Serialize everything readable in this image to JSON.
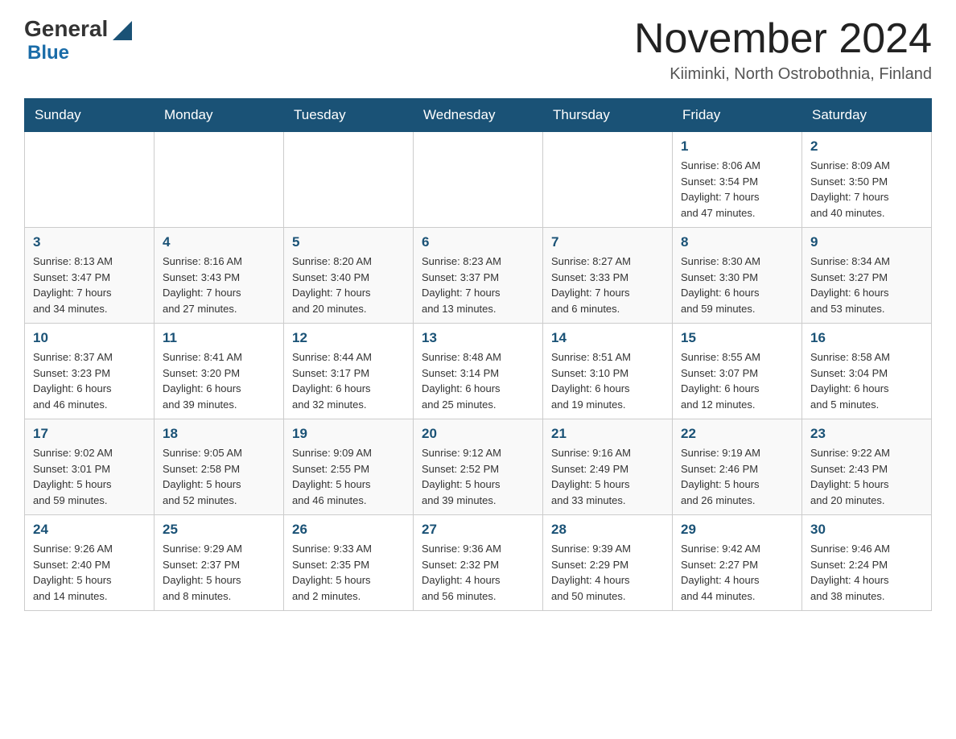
{
  "header": {
    "logo_general": "General",
    "logo_blue": "Blue",
    "month_title": "November 2024",
    "location": "Kiiminki, North Ostrobothnia, Finland"
  },
  "weekdays": [
    "Sunday",
    "Monday",
    "Tuesday",
    "Wednesday",
    "Thursday",
    "Friday",
    "Saturday"
  ],
  "weeks": [
    [
      {
        "day": "",
        "info": ""
      },
      {
        "day": "",
        "info": ""
      },
      {
        "day": "",
        "info": ""
      },
      {
        "day": "",
        "info": ""
      },
      {
        "day": "",
        "info": ""
      },
      {
        "day": "1",
        "info": "Sunrise: 8:06 AM\nSunset: 3:54 PM\nDaylight: 7 hours\nand 47 minutes."
      },
      {
        "day": "2",
        "info": "Sunrise: 8:09 AM\nSunset: 3:50 PM\nDaylight: 7 hours\nand 40 minutes."
      }
    ],
    [
      {
        "day": "3",
        "info": "Sunrise: 8:13 AM\nSunset: 3:47 PM\nDaylight: 7 hours\nand 34 minutes."
      },
      {
        "day": "4",
        "info": "Sunrise: 8:16 AM\nSunset: 3:43 PM\nDaylight: 7 hours\nand 27 minutes."
      },
      {
        "day": "5",
        "info": "Sunrise: 8:20 AM\nSunset: 3:40 PM\nDaylight: 7 hours\nand 20 minutes."
      },
      {
        "day": "6",
        "info": "Sunrise: 8:23 AM\nSunset: 3:37 PM\nDaylight: 7 hours\nand 13 minutes."
      },
      {
        "day": "7",
        "info": "Sunrise: 8:27 AM\nSunset: 3:33 PM\nDaylight: 7 hours\nand 6 minutes."
      },
      {
        "day": "8",
        "info": "Sunrise: 8:30 AM\nSunset: 3:30 PM\nDaylight: 6 hours\nand 59 minutes."
      },
      {
        "day": "9",
        "info": "Sunrise: 8:34 AM\nSunset: 3:27 PM\nDaylight: 6 hours\nand 53 minutes."
      }
    ],
    [
      {
        "day": "10",
        "info": "Sunrise: 8:37 AM\nSunset: 3:23 PM\nDaylight: 6 hours\nand 46 minutes."
      },
      {
        "day": "11",
        "info": "Sunrise: 8:41 AM\nSunset: 3:20 PM\nDaylight: 6 hours\nand 39 minutes."
      },
      {
        "day": "12",
        "info": "Sunrise: 8:44 AM\nSunset: 3:17 PM\nDaylight: 6 hours\nand 32 minutes."
      },
      {
        "day": "13",
        "info": "Sunrise: 8:48 AM\nSunset: 3:14 PM\nDaylight: 6 hours\nand 25 minutes."
      },
      {
        "day": "14",
        "info": "Sunrise: 8:51 AM\nSunset: 3:10 PM\nDaylight: 6 hours\nand 19 minutes."
      },
      {
        "day": "15",
        "info": "Sunrise: 8:55 AM\nSunset: 3:07 PM\nDaylight: 6 hours\nand 12 minutes."
      },
      {
        "day": "16",
        "info": "Sunrise: 8:58 AM\nSunset: 3:04 PM\nDaylight: 6 hours\nand 5 minutes."
      }
    ],
    [
      {
        "day": "17",
        "info": "Sunrise: 9:02 AM\nSunset: 3:01 PM\nDaylight: 5 hours\nand 59 minutes."
      },
      {
        "day": "18",
        "info": "Sunrise: 9:05 AM\nSunset: 2:58 PM\nDaylight: 5 hours\nand 52 minutes."
      },
      {
        "day": "19",
        "info": "Sunrise: 9:09 AM\nSunset: 2:55 PM\nDaylight: 5 hours\nand 46 minutes."
      },
      {
        "day": "20",
        "info": "Sunrise: 9:12 AM\nSunset: 2:52 PM\nDaylight: 5 hours\nand 39 minutes."
      },
      {
        "day": "21",
        "info": "Sunrise: 9:16 AM\nSunset: 2:49 PM\nDaylight: 5 hours\nand 33 minutes."
      },
      {
        "day": "22",
        "info": "Sunrise: 9:19 AM\nSunset: 2:46 PM\nDaylight: 5 hours\nand 26 minutes."
      },
      {
        "day": "23",
        "info": "Sunrise: 9:22 AM\nSunset: 2:43 PM\nDaylight: 5 hours\nand 20 minutes."
      }
    ],
    [
      {
        "day": "24",
        "info": "Sunrise: 9:26 AM\nSunset: 2:40 PM\nDaylight: 5 hours\nand 14 minutes."
      },
      {
        "day": "25",
        "info": "Sunrise: 9:29 AM\nSunset: 2:37 PM\nDaylight: 5 hours\nand 8 minutes."
      },
      {
        "day": "26",
        "info": "Sunrise: 9:33 AM\nSunset: 2:35 PM\nDaylight: 5 hours\nand 2 minutes."
      },
      {
        "day": "27",
        "info": "Sunrise: 9:36 AM\nSunset: 2:32 PM\nDaylight: 4 hours\nand 56 minutes."
      },
      {
        "day": "28",
        "info": "Sunrise: 9:39 AM\nSunset: 2:29 PM\nDaylight: 4 hours\nand 50 minutes."
      },
      {
        "day": "29",
        "info": "Sunrise: 9:42 AM\nSunset: 2:27 PM\nDaylight: 4 hours\nand 44 minutes."
      },
      {
        "day": "30",
        "info": "Sunrise: 9:46 AM\nSunset: 2:24 PM\nDaylight: 4 hours\nand 38 minutes."
      }
    ]
  ]
}
